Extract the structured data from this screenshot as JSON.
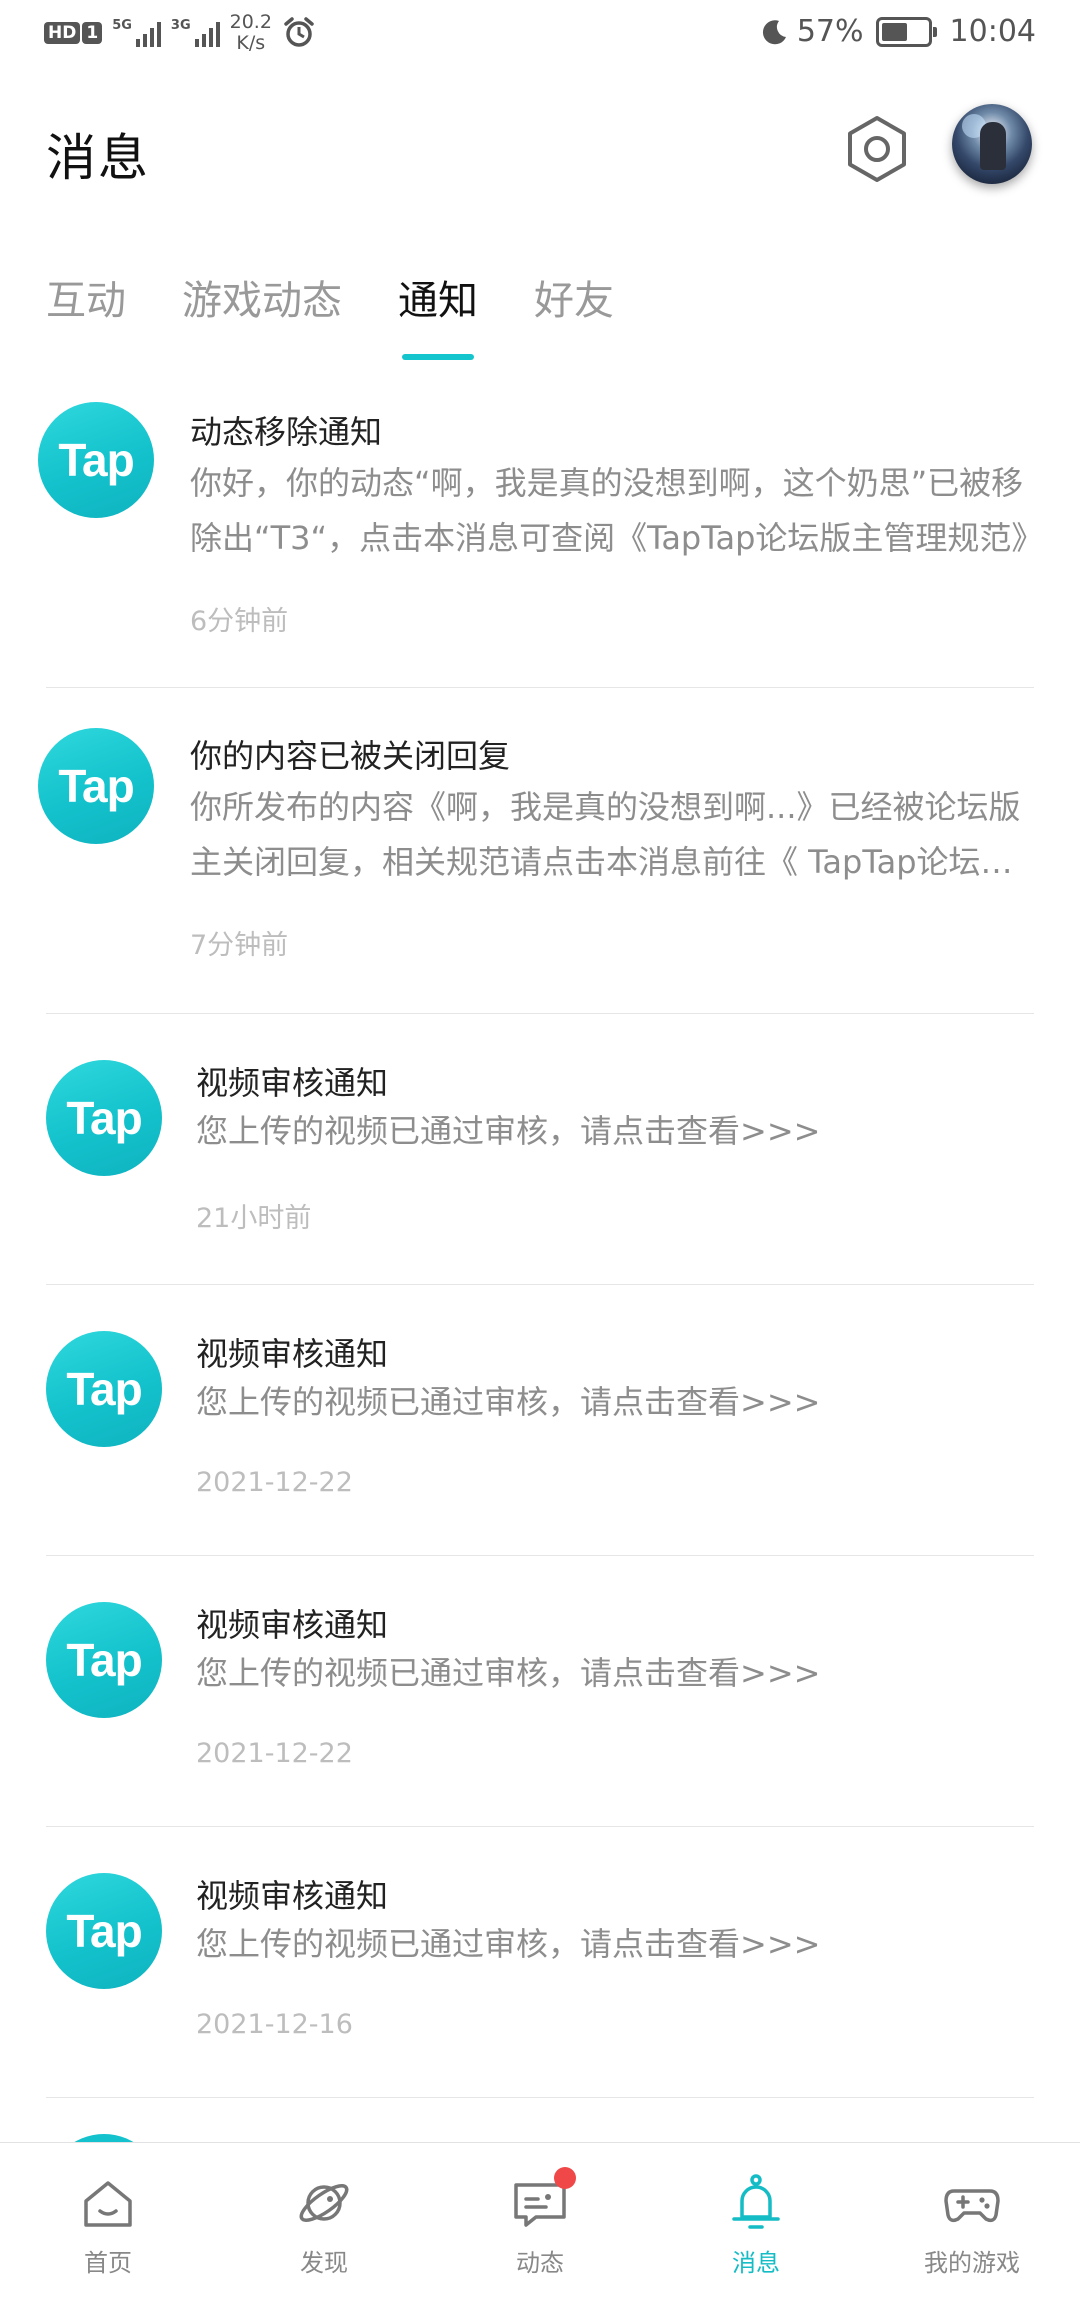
{
  "status_bar": {
    "hd_label": "HD",
    "sim_label": "1",
    "signal1_net": "5G",
    "signal2_net": "3G",
    "speed_value": "20.2",
    "speed_unit": "K/s",
    "battery_percent": "57%",
    "battery_level": 0.57,
    "time": "10:04"
  },
  "header": {
    "title": "消息",
    "settings_icon": "settings-hexagon-icon"
  },
  "tabs": [
    {
      "label": "互动",
      "active": false
    },
    {
      "label": "游戏动态",
      "active": false
    },
    {
      "label": "通知",
      "active": true
    },
    {
      "label": "好友",
      "active": false
    }
  ],
  "notifications": [
    {
      "logo": "Tap",
      "title": "动态移除通知",
      "body": "你好，你的动态“啊，我是真的没想到啊，这个奶思”已被移除出“T3“，点击本消息可查阅《TapTap论坛版主管理规范》",
      "time": "6分钟前"
    },
    {
      "logo": "Tap",
      "title": "你的内容已被关闭回复",
      "body": "你所发布的内容《啊，我是真的没想到啊...》已经被论坛版主关闭回复，相关规范请点击本消息前往《 TapTap论坛版主管理规范》",
      "time": "7分钟前"
    },
    {
      "logo": "Tap",
      "title": "视频审核通知",
      "body": "您上传的视频已通过审核，请点击查看>>>",
      "time": "21小时前"
    },
    {
      "logo": "Tap",
      "title": "视频审核通知",
      "body": "您上传的视频已通过审核，请点击查看>>>",
      "time": "2021-12-22"
    },
    {
      "logo": "Tap",
      "title": "视频审核通知",
      "body": "您上传的视频已通过审核，请点击查看>>>",
      "time": "2021-12-22"
    },
    {
      "logo": "Tap",
      "title": "视频审核通知",
      "body": "您上传的视频已通过审核，请点击查看>>>",
      "time": "2021-12-16"
    }
  ],
  "bottom_nav": [
    {
      "label": "首页",
      "icon": "home-icon",
      "active": false
    },
    {
      "label": "发现",
      "icon": "planet-icon",
      "active": false
    },
    {
      "label": "动态",
      "icon": "chat-icon",
      "active": false,
      "badge": true
    },
    {
      "label": "消息",
      "icon": "bell-icon",
      "active": true
    },
    {
      "label": "我的游戏",
      "icon": "gamepad-icon",
      "active": false
    }
  ],
  "colors": {
    "accent": "#15c5ce",
    "badge": "#f04848",
    "muted_text": "#8d8d8d",
    "time_text": "#bdbdbd"
  }
}
